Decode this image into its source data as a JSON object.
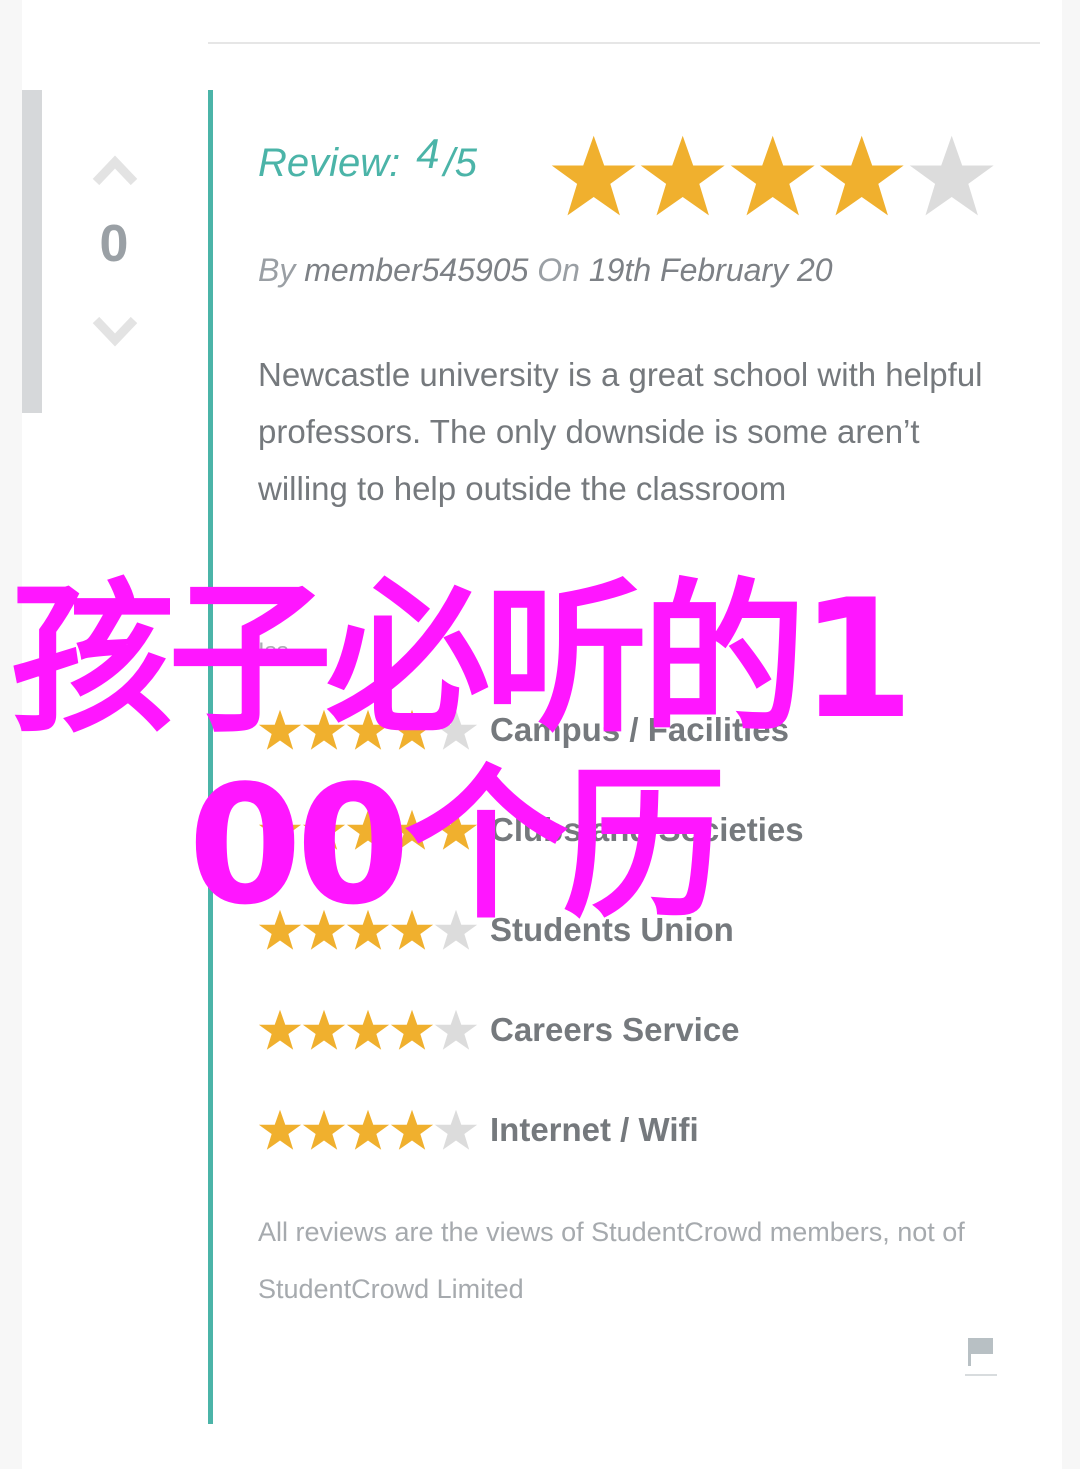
{
  "vote": {
    "count": "0"
  },
  "review": {
    "label": "Review:",
    "score": "4",
    "slash": "/",
    "max": "5",
    "rating": 4,
    "rating_max": 5
  },
  "byline": {
    "by": "By",
    "author": "member545905",
    "on": "On",
    "date": "19th February 20"
  },
  "body": "Newcastle university is a great school with helpful professors. The only downside is some aren’t willing to help outside the classroom",
  "categories_heading": "Iss",
  "ratings": [
    {
      "label": "Campus / Facilities",
      "stars": 4
    },
    {
      "label": "Clubs and Societies",
      "stars": 5
    },
    {
      "label": "Students Union",
      "stars": 4
    },
    {
      "label": "Careers Service",
      "stars": 4
    },
    {
      "label": "Internet / Wifi",
      "stars": 4
    }
  ],
  "disclaimer": "All reviews are the views of StudentCrowd members, not of StudentCrowd Limited",
  "overlay": {
    "line1": "孩子必听的1",
    "line2": "00个历"
  },
  "colors": {
    "accent": "#4bb4a8",
    "star_on": "#f0b02e",
    "star_off": "#dcdcdc",
    "overlay": "#ff16ff"
  },
  "icons": {
    "vote_up": "chevron-up-icon",
    "vote_down": "chevron-down-icon",
    "report": "flag-icon"
  }
}
